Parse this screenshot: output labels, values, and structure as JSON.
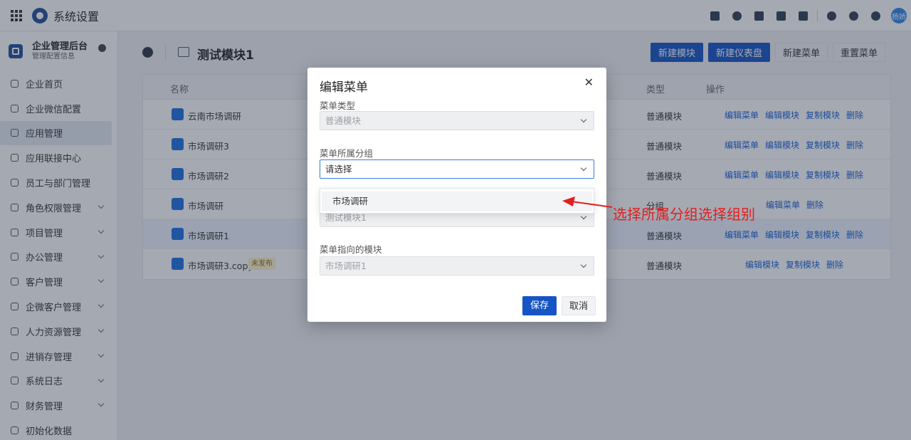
{
  "app": {
    "title": "系统设置",
    "avatar_text": "杨娇"
  },
  "topbar_icons": [
    "calendar-check-icon",
    "contacts-icon",
    "document-icon",
    "phone-book-icon",
    "calendar-icon",
    "bell-icon",
    "help-icon",
    "gear-icon"
  ],
  "sidebar": {
    "title": "企业管理后台",
    "subtitle": "管理配置信息",
    "items": [
      {
        "label": "企业首页",
        "icon": "home-icon",
        "expandable": false
      },
      {
        "label": "企业微信配置",
        "icon": "wechat-icon",
        "expandable": false
      },
      {
        "label": "应用管理",
        "icon": "apps-icon",
        "expandable": false,
        "active": true
      },
      {
        "label": "应用联接中心",
        "icon": "link-icon",
        "expandable": false
      },
      {
        "label": "员工与部门管理",
        "icon": "people-icon",
        "expandable": false
      },
      {
        "label": "角色权限管理",
        "icon": "role-icon",
        "expandable": true
      },
      {
        "label": "项目管理",
        "icon": "project-icon",
        "expandable": true
      },
      {
        "label": "办公管理",
        "icon": "office-icon",
        "expandable": true
      },
      {
        "label": "客户管理",
        "icon": "customer-icon",
        "expandable": true
      },
      {
        "label": "企微客户管理",
        "icon": "wecom-customer-icon",
        "expandable": true
      },
      {
        "label": "人力资源管理",
        "icon": "hr-icon",
        "expandable": true
      },
      {
        "label": "进销存管理",
        "icon": "inventory-icon",
        "expandable": true
      },
      {
        "label": "系统日志",
        "icon": "log-icon",
        "expandable": true
      },
      {
        "label": "财务管理",
        "icon": "finance-icon",
        "expandable": true
      },
      {
        "label": "初始化数据",
        "icon": "init-data-icon",
        "expandable": false
      }
    ]
  },
  "page": {
    "title": "测试模块1",
    "actions": {
      "new_module": "新建模块",
      "new_dashboard": "新建仪表盘",
      "new_menu": "新建菜单",
      "reset_menu": "重置菜单"
    }
  },
  "table": {
    "headers": {
      "name": "名称",
      "type": "类型",
      "ops": "操作"
    },
    "rows": [
      {
        "name": "云南市场调研",
        "type": "普通模块",
        "ops": [
          "编辑菜单",
          "编辑模块",
          "复制模块",
          "删除"
        ],
        "icon": "tag-icon"
      },
      {
        "name": "市场调研3",
        "type": "普通模块",
        "ops": [
          "编辑菜单",
          "编辑模块",
          "复制模块",
          "删除"
        ],
        "icon": "module-icon"
      },
      {
        "name": "市场调研2",
        "type": "普通模块",
        "ops": [
          "编辑菜单",
          "编辑模块",
          "复制模块",
          "删除"
        ],
        "icon": "module-icon"
      },
      {
        "name": "市场调研",
        "type": "分组",
        "ops": [
          "编辑菜单",
          "删除"
        ],
        "icon": "check-icon"
      },
      {
        "name": "市场调研1",
        "type": "普通模块",
        "ops": [
          "编辑菜单",
          "编辑模块",
          "复制模块",
          "删除"
        ],
        "icon": "form-icon",
        "selected": true
      },
      {
        "name": "市场调研3.copy",
        "badge": "未发布",
        "type": "普通模块",
        "ops": [
          "编辑模块",
          "复制模块",
          "删除"
        ],
        "icon": "module-icon"
      }
    ]
  },
  "modal": {
    "title": "编辑菜单",
    "fields": {
      "menu_type": {
        "label": "菜单类型",
        "value": "普通模块"
      },
      "group": {
        "label": "菜单所属分组",
        "placeholder": "请选择"
      },
      "hidden_field_value": "测试模块1",
      "target_module": {
        "label": "菜单指向的模块",
        "value": "市场调研1"
      }
    },
    "dropdown_options": [
      "市场调研"
    ],
    "save": "保存",
    "cancel": "取消"
  },
  "annotation": {
    "text": "选择所属分组选择组别",
    "color": "#e02020"
  }
}
